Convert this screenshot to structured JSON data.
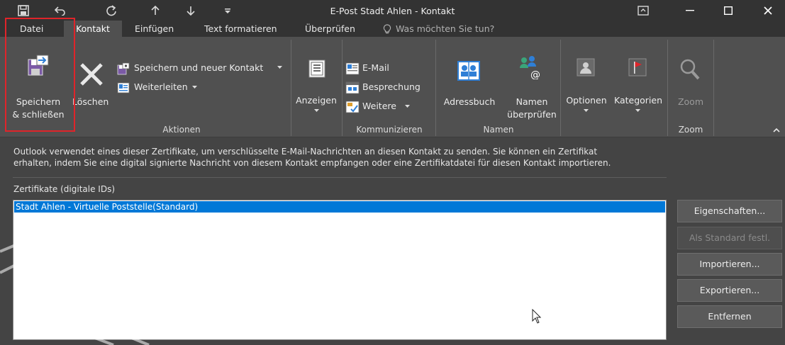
{
  "window": {
    "title": "E-Post Stadt Ahlen - Kontakt"
  },
  "tabs": [
    {
      "label": "Datei"
    },
    {
      "label": "Kontakt"
    },
    {
      "label": "Einfügen"
    },
    {
      "label": "Text formatieren"
    },
    {
      "label": "Überprüfen"
    }
  ],
  "tell_me": {
    "placeholder": "Was möchten Sie tun?"
  },
  "ribbon": {
    "aktionen": {
      "save_close_line1": "Speichern",
      "save_close_line2": "& schließen",
      "delete": "Löschen",
      "save_new": "Speichern und neuer Kontakt",
      "forward": "Weiterleiten",
      "group_label": "Aktionen"
    },
    "anzeigen": {
      "label": "Anzeigen"
    },
    "kommunizieren": {
      "email": "E-Mail",
      "meeting": "Besprechung",
      "more": "Weitere",
      "group_label": "Kommunizieren"
    },
    "namen": {
      "address_book": "Adressbuch",
      "check_names_line1": "Namen",
      "check_names_line2": "überprüfen",
      "group_label": "Namen"
    },
    "optionen": {
      "label": "Optionen"
    },
    "kategorien": {
      "label": "Kategorien"
    },
    "zoom": {
      "label": "Zoom",
      "group_label": "Zoom"
    }
  },
  "body": {
    "info_line1": "Outlook verwendet eines dieser Zertifikate, um verschlüsselte E-Mail-Nachrichten an diesen Kontakt zu senden. Sie können ein Zertifikat",
    "info_line2": "erhalten, indem Sie eine digital signierte Nachricht von diesem Kontakt empfangen oder eine Zertifikatdatei für diesen Kontakt importieren.",
    "cert_label": "Zertifikate (digitale IDs)",
    "certificates": [
      {
        "name": "Stadt Ahlen - Virtuelle Poststelle(Standard)",
        "selected": true
      }
    ]
  },
  "buttons": {
    "properties": "Eigenschaften...",
    "set_default": "Als Standard festl.",
    "import": "Importieren...",
    "export": "Exportieren...",
    "remove": "Entfernen"
  },
  "colors": {
    "titlebar": "#333333",
    "ribbon": "#505050",
    "body": "#444444",
    "selection": "#0078d7",
    "highlight": "#e0242a"
  }
}
